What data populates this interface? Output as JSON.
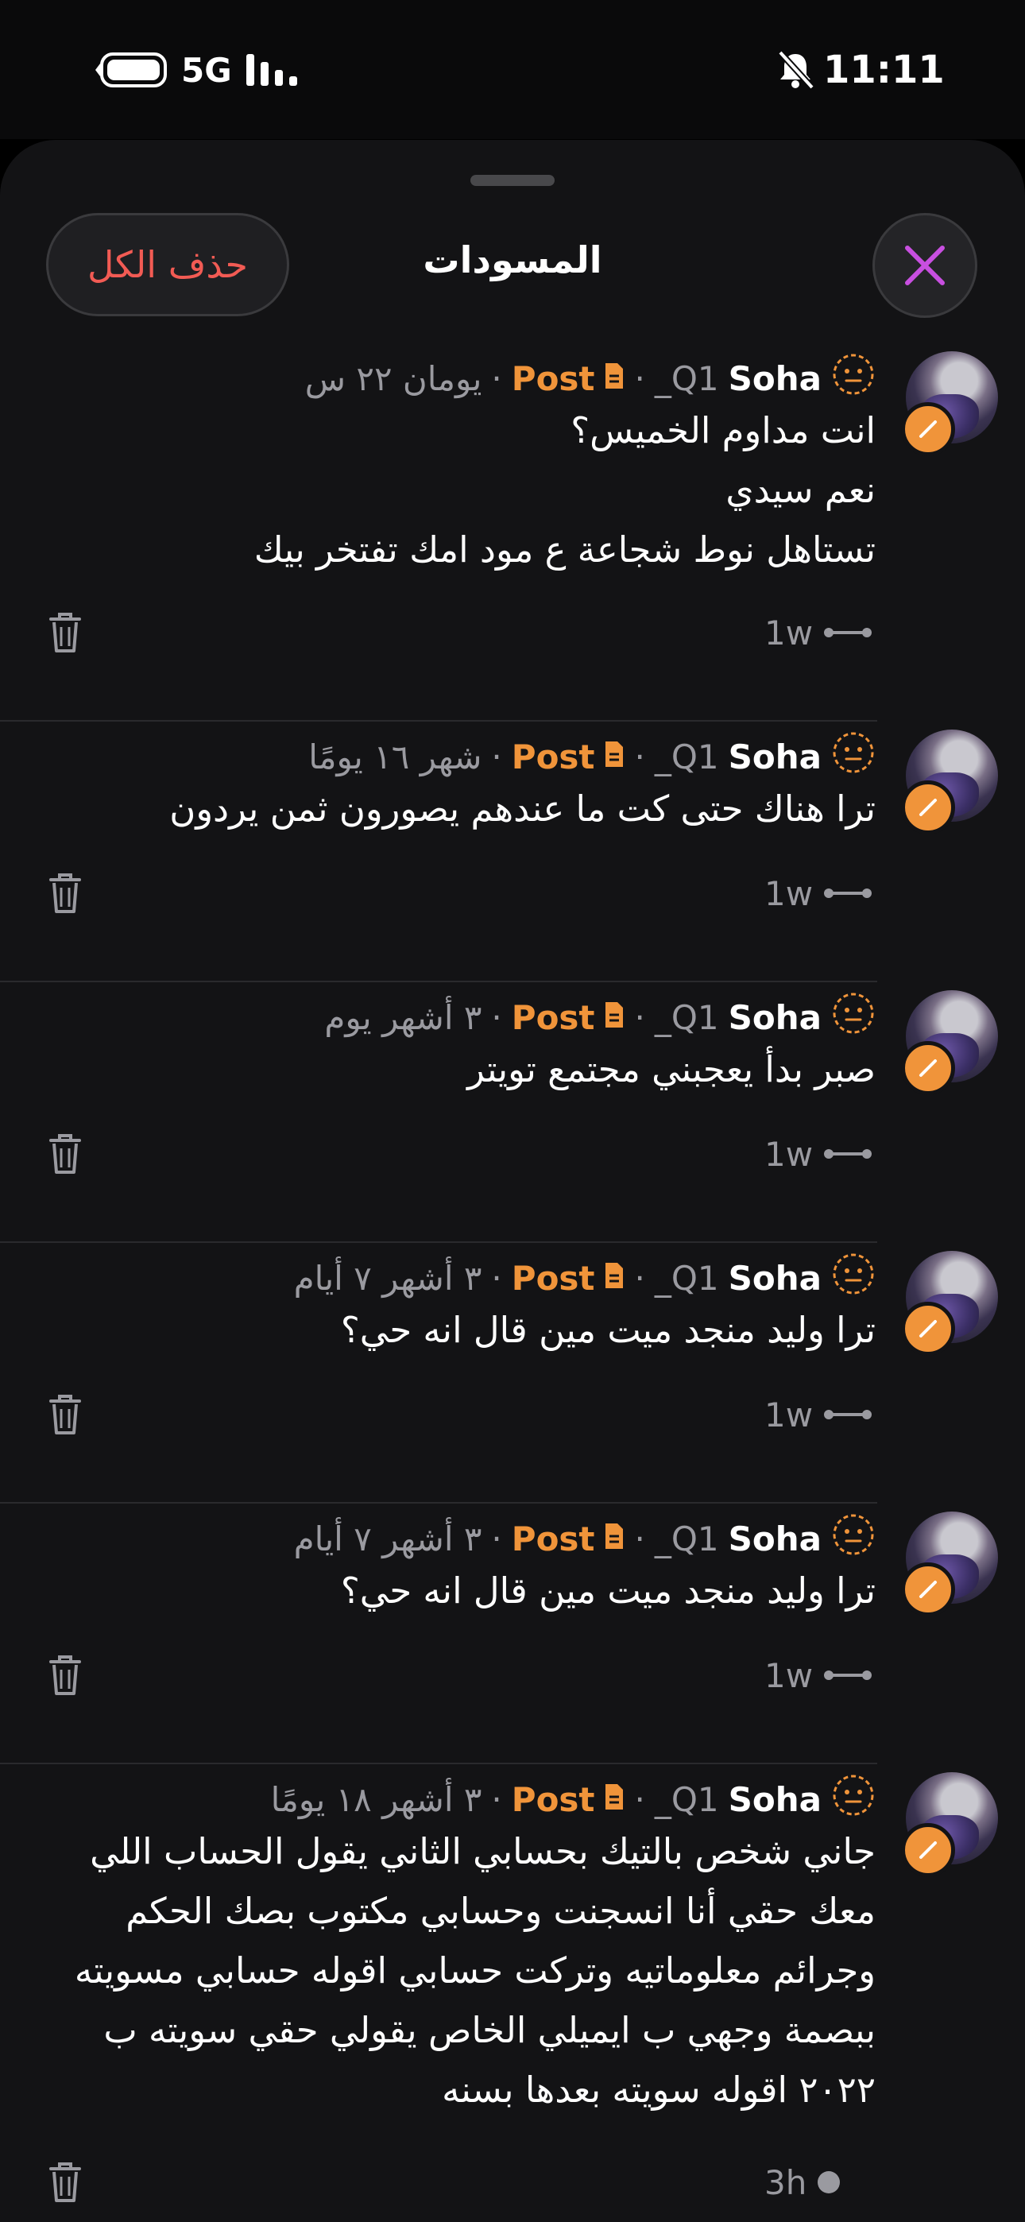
{
  "status_bar": {
    "network": "5G",
    "time": "11:11"
  },
  "header": {
    "delete_all_label": "حذف الكل",
    "title": "المسودات"
  },
  "drafts": [
    {
      "name": "Soha",
      "handle": "Q1_",
      "type": "Post",
      "when": "يومان ٢٢ س",
      "text": "انت مداوم الخميس؟\nنعم سيدي\nتستاهل نوط شجاعة ع مود امك تفتخر بيك",
      "age": "1w",
      "status": "thread"
    },
    {
      "name": "Soha",
      "handle": "Q1_",
      "type": "Post",
      "when": "شهر ١٦ يومًا",
      "text": "ترا هناك حتى كت ما عندهم يصورون ثمن يردون",
      "age": "1w",
      "status": "thread"
    },
    {
      "name": "Soha",
      "handle": "Q1_",
      "type": "Post",
      "when": "٣ أشهر يوم",
      "text": "صبر بدأ يعجبني مجتمع تويتر",
      "age": "1w",
      "status": "thread"
    },
    {
      "name": "Soha",
      "handle": "Q1_",
      "type": "Post",
      "when": "٣ أشهر ٧ أيام",
      "text": "ترا وليد منجد ميت مين قال انه حي؟",
      "age": "1w",
      "status": "thread"
    },
    {
      "name": "Soha",
      "handle": "Q1_",
      "type": "Post",
      "when": "٣ أشهر ٧ أيام",
      "text": "ترا وليد منجد ميت مين قال انه حي؟",
      "age": "1w",
      "status": "thread"
    },
    {
      "name": "Soha",
      "handle": "Q1_",
      "type": "Post",
      "when": "٣ أشهر ١٨ يومًا",
      "text": "جاني شخص بالتيك بحسابي الثاني يقول الحساب اللي\nمعك حقي أنا انسجنت وحسابي مكتوب بصك الحكم\nوجرائم معلوماتيه وتركت حسابي اقوله حسابي مسويته\nببصمة وجهي ب ايميلي الخاص يقولي حقي سويته ب\n٢٠٢٢ اقوله سويته بعدها بسنه",
      "age": "3h",
      "status": "dot"
    }
  ],
  "colors": {
    "accent": "#f0943a",
    "danger": "#f25b54",
    "close_x": "#c84fe0"
  },
  "icons": [
    "battery-icon",
    "signal-icon",
    "mute-bell-icon",
    "close-icon",
    "avatar",
    "pencil-icon",
    "neutral-face-icon",
    "document-icon",
    "trash-icon",
    "thread-icon",
    "dot-icon"
  ]
}
